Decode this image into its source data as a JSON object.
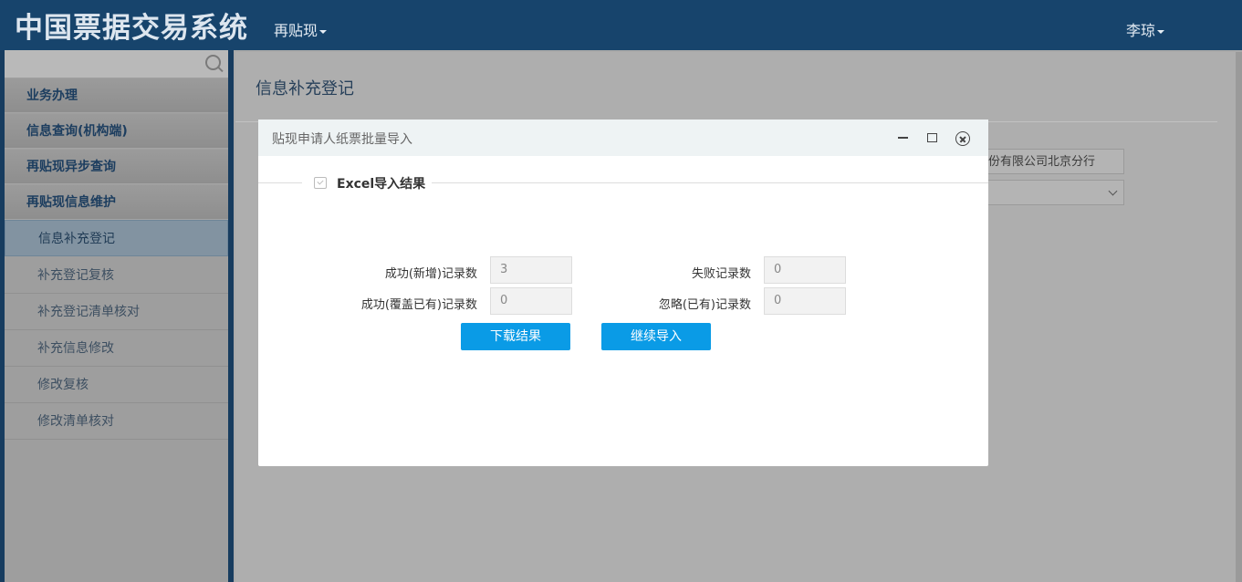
{
  "header": {
    "brand": "中国票据交易系统",
    "menu_label": "再贴现",
    "user_name": "李琼"
  },
  "sidebar": {
    "groups": [
      "业务办理",
      "信息查询(机构端)",
      "再贴现异步查询",
      "再贴现信息维护"
    ],
    "items": [
      "信息补充登记",
      "补充登记复核",
      "补充登记清单核对",
      "补充信息修改",
      "修改复核",
      "修改清单核对"
    ]
  },
  "main": {
    "title": "信息补充登记",
    "field_bank": "份有限公司北京分行"
  },
  "modal": {
    "title": "贴现申请人纸票批量导入",
    "section_title": "Excel导入结果",
    "labels": {
      "success_new": "成功(新增)记录数",
      "fail": "失败记录数",
      "success_overwrite": "成功(覆盖已有)记录数",
      "ignored": "忽略(已有)记录数"
    },
    "values": {
      "success_new": "3",
      "fail": "0",
      "success_overwrite": "0",
      "ignored": "0"
    },
    "download_button": "下载结果",
    "continue_button": "继续导入"
  }
}
